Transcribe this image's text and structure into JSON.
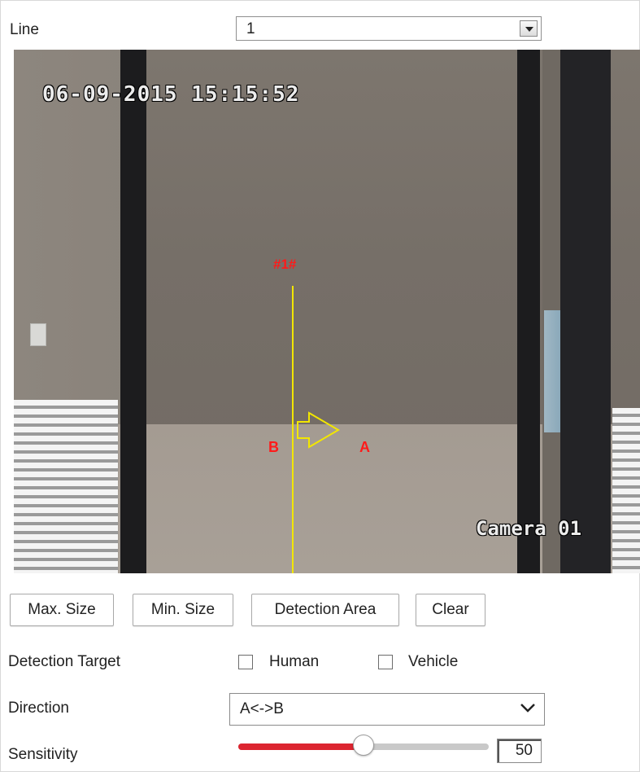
{
  "line": {
    "label": "Line",
    "selected": "1"
  },
  "video": {
    "timestamp": "06-09-2015 15:15:52",
    "camera_name": "Camera 01",
    "overlay": {
      "line_label": "#1#",
      "side_a": "A",
      "side_b": "B",
      "line_color": "#f2e600",
      "text_color": "#ff1a1a"
    }
  },
  "buttons": {
    "max_size": "Max. Size",
    "min_size": "Min. Size",
    "detection_area": "Detection Area",
    "clear": "Clear"
  },
  "detection_target": {
    "label": "Detection Target",
    "options": [
      {
        "label": "Human",
        "checked": false
      },
      {
        "label": "Vehicle",
        "checked": false
      }
    ]
  },
  "direction": {
    "label": "Direction",
    "selected": "A<->B"
  },
  "sensitivity": {
    "label": "Sensitivity",
    "value": "50",
    "fraction": 0.5,
    "accent_color": "#dc2530"
  }
}
